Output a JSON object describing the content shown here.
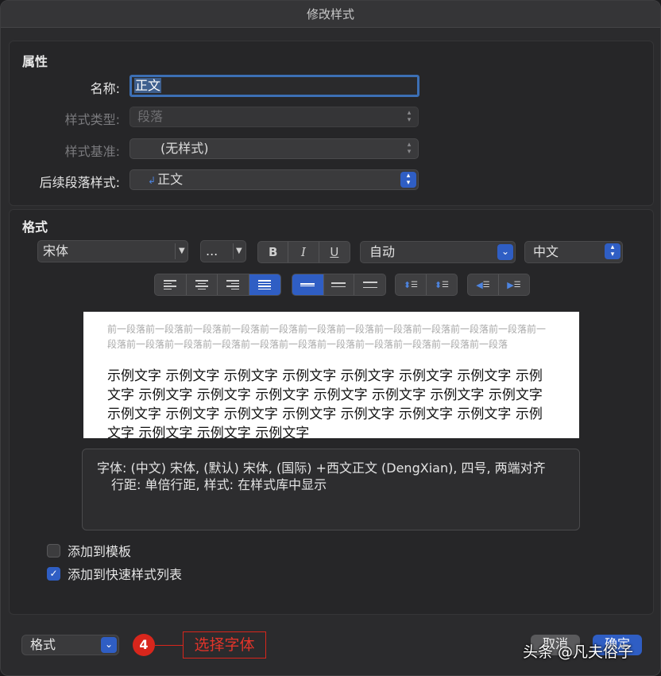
{
  "dialog": {
    "title": "修改样式"
  },
  "properties": {
    "section_title": "属性",
    "name_label": "名称:",
    "name_value": "正文",
    "type_label": "样式类型:",
    "type_value": "段落",
    "based_on_label": "样式基准:",
    "based_on_value": "(无样式)",
    "next_label": "后续段落样式:",
    "next_value": "正文",
    "next_icon": "paragraph-style-icon"
  },
  "format": {
    "section_title": "格式",
    "font_name": "宋体",
    "font_size": "...",
    "bold_label": "B",
    "italic_label": "I",
    "underline_label": "U",
    "color_value": "自动",
    "script_value": "中文",
    "alignment_selected": "justify",
    "spacing_selected": "single",
    "accent_color": "#2f5ec4"
  },
  "preview": {
    "previous_paragraph": "前一段落前一段落前一段落前一段落前一段落前一段落前一段落前一段落前一段落前一段落前一段落前一段落前一段落前一段落前一段落前一段落前一段落前一段落前一段落前一段落前一段落前一段落",
    "sample_text": "示例文字 示例文字 示例文字 示例文字 示例文字 示例文字 示例文字 示例文字 示例文字 示例文字 示例文字 示例文字 示例文字 示例文字 示例文字 示例文字 示例文字 示例文字 示例文字 示例文字 示例文字 示例文字 示例文字 示例文字 示例文字 示例文字"
  },
  "description": {
    "line1": "字体: (中文) 宋体, (默认) 宋体, (国际) +西文正文 (DengXian), 四号, 两端对齐",
    "line2": "行距: 单倍行距, 样式: 在样式库中显示"
  },
  "options": {
    "add_to_template": {
      "label": "添加到模板",
      "checked": false
    },
    "add_to_quick_styles": {
      "label": "添加到快速样式列表",
      "checked": true
    }
  },
  "footer": {
    "format_button": "格式",
    "cancel_button": "取消",
    "ok_button": "确定",
    "annotation_step": "4",
    "annotation_text": "选择字体",
    "annotation_color": "#d8261c",
    "watermark": "头条 @凡夫俗子"
  }
}
